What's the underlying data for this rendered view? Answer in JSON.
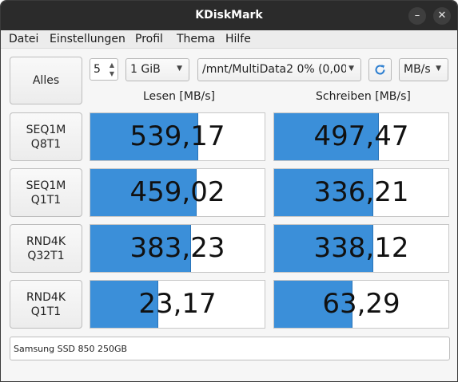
{
  "window": {
    "title": "KDiskMark",
    "minimize_glyph": "–",
    "close_glyph": "✕"
  },
  "menu": [
    "Datei",
    "Einstellungen",
    "Profil",
    "Thema",
    "Hilfe"
  ],
  "toolbar": {
    "all_label": "Alles",
    "runs": "5",
    "size": "1 GiB",
    "drive": "/mnt/MultiData2 0% (0,00,",
    "unit": "MB/s",
    "refresh_icon": "refresh-icon"
  },
  "columns": {
    "read": "Lesen [MB/s]",
    "write": "Schreiben [MB/s]"
  },
  "tests": [
    {
      "line1": "SEQ1M",
      "line2": "Q8T1",
      "read": "539,17",
      "write": "497,47",
      "read_fill": 0.62,
      "write_fill": 0.6
    },
    {
      "line1": "SEQ1M",
      "line2": "Q1T1",
      "read": "459,02",
      "write": "336,21",
      "read_fill": 0.61,
      "write_fill": 0.57
    },
    {
      "line1": "RND4K",
      "line2": "Q32T1",
      "read": "383,23",
      "write": "338,12",
      "read_fill": 0.58,
      "write_fill": 0.57
    },
    {
      "line1": "RND4K",
      "line2": "Q1T1",
      "read": "23,17",
      "write": "63,29",
      "read_fill": 0.39,
      "write_fill": 0.45
    }
  ],
  "status": {
    "device": "Samsung SSD 850 250GB"
  },
  "colors": {
    "bar": "#3b8fd9",
    "titlebar": "#2b2b2b"
  }
}
